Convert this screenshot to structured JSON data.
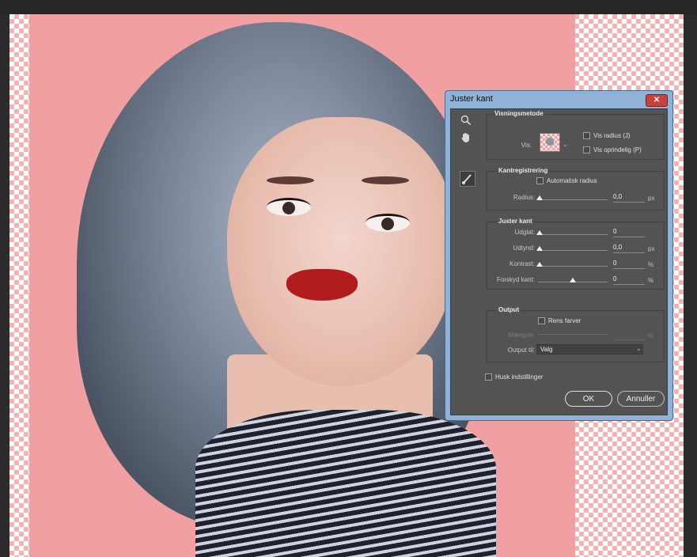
{
  "dialog": {
    "title": "Juster kant",
    "close_label": "✕",
    "view_mode": {
      "title": "Visningsmetode",
      "view_label": "Vis:",
      "show_radius_label": "Vis radius (J)",
      "show_original_label": "Vis oprindelig (P)"
    },
    "edge_detection": {
      "title": "Kantregistrering",
      "auto_radius_label": "Automatisk radius",
      "radius_label": "Radius:",
      "radius_value": "0,0",
      "radius_unit": "px"
    },
    "adjust_edge": {
      "title": "Juster kant",
      "smooth_label": "Udglat:",
      "smooth_value": "0",
      "feather_label": "Udtynd:",
      "feather_value": "0,0",
      "feather_unit": "px",
      "contrast_label": "Kontrast:",
      "contrast_value": "0",
      "contrast_unit": "%",
      "shift_label": "Forskyd kant:",
      "shift_value": "0",
      "shift_unit": "%"
    },
    "output": {
      "title": "Output",
      "decontaminate_label": "Rens farver",
      "amount_label": "Mængde:",
      "amount_unit": "%",
      "output_to_label": "Output til:",
      "output_to_value": "Valg"
    },
    "remember_label": "Husk indstillinger",
    "ok_label": "OK",
    "cancel_label": "Annuller"
  },
  "icons": {
    "zoom": "zoom-icon",
    "hand": "hand-icon",
    "refine_brush": "refine-radius-brush-icon"
  },
  "colors": {
    "background_pink": "#f0a0a0",
    "dialog_frame": "#8fb2d6",
    "dialog_body": "#535353",
    "close_button": "#c8413a"
  }
}
